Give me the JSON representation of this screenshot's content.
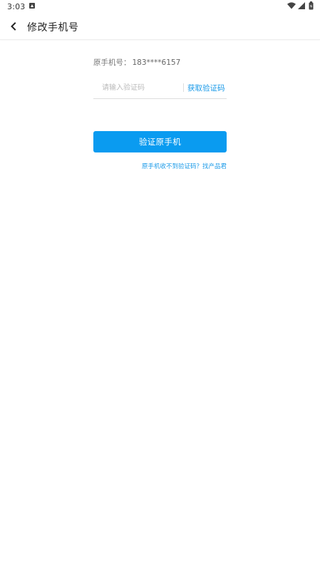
{
  "status_bar": {
    "time": "3:03",
    "icons": [
      "notification-icon",
      "wifi-icon",
      "signal-icon",
      "battery-icon"
    ]
  },
  "toolbar": {
    "back_icon": "chevron-left-icon",
    "title": "修改手机号"
  },
  "form": {
    "original_phone_label": "原手机号：",
    "original_phone_value": "183****6157",
    "code_placeholder": "请输入验证码",
    "get_code_label": "获取验证码",
    "verify_button_label": "验证原手机",
    "help_link_label": "原手机收不到验证码？找产品君"
  },
  "colors": {
    "accent": "#0a9bf0",
    "link": "#1a9ae8"
  }
}
